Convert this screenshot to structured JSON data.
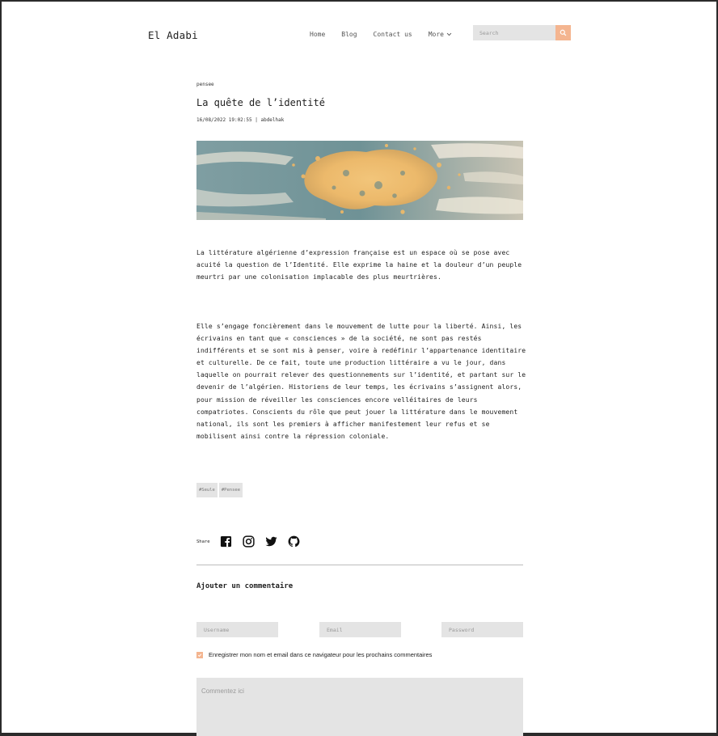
{
  "brand": "El Adabi",
  "nav": {
    "links": [
      "Home",
      "Blog",
      "Contact us"
    ],
    "more_label": "More",
    "search_placeholder": "Search"
  },
  "article": {
    "category": "pensee",
    "title": "La quête de l’identité",
    "meta": "16/08/2022 19:02:55 | abdelhak",
    "paragraphs": [
      "La littérature algérienne d’expression française est un espace où se pose avec acuité la question de l’Identité. Elle exprime la haine et la douleur d’un peuple meurtri par une colonisation implacable des plus meurtrières.",
      "Elle s’engage foncièrement dans le mouvement de lutte pour la liberté. Ainsi, les écrivains en tant que « consciences » de la société, ne sont pas restés indifférents et se sont mis à penser, voire à redéfinir l’appartenance identitaire et culturelle. De ce fait, toute une production littéraire a vu le jour, dans laquelle on pourrait relever des questionnements sur l’identité, et partant sur le devenir de l’algérien. Historiens de leur temps, les écrivains s’assignent alors, pour mission de réveiller les consciences encore velléitaires de leurs compatriotes. Conscients du rôle que peut jouer la littérature dans le mouvement national, ils sont les premiers à afficher manifestement leur refus et se mobilisent ainsi contre la répression coloniale."
    ],
    "tags": [
      "#Seule",
      "#Pensee"
    ]
  },
  "share": {
    "label": "Share",
    "icons": [
      "facebook-icon",
      "instagram-icon",
      "twitter-icon",
      "github-icon"
    ]
  },
  "comments": {
    "heading": "Ajouter un commentaire",
    "username_placeholder": "Username",
    "email_placeholder": "Email",
    "password_placeholder": "Password",
    "remember_label": "Enregistrer mon nom et email dans ce navigateur pour les prochains commentaires",
    "remember_checked": true,
    "comment_placeholder": "Commentez ici"
  },
  "colors": {
    "accent": "#f4b590",
    "field_bg": "#e4e4e4"
  }
}
